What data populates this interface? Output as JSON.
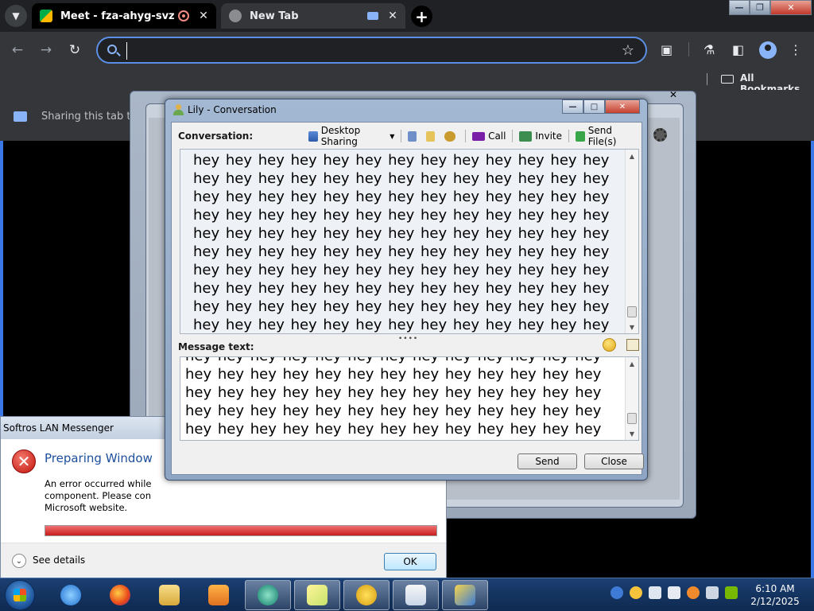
{
  "chrome": {
    "tabs": [
      {
        "title": "Meet - fza-ahyg-svz"
      },
      {
        "title": "New Tab"
      }
    ],
    "omnibox": {
      "value": "",
      "placeholder": ""
    },
    "bookmarks": {
      "all_label": "All Bookmarks"
    },
    "sharing_bar_text": "Sharing this tab to"
  },
  "error_dialog": {
    "title": "Softros LAN Messenger",
    "heading": "Preparing Window",
    "body_line1": "An error occurred while",
    "body_line2": "component. Please con",
    "body_line3": "Microsoft website.",
    "progress_percent": 100,
    "details_label": "See details",
    "ok_label": "OK"
  },
  "conversation": {
    "title": "Lily - Conversation",
    "conversation_label": "Conversation:",
    "tools": {
      "desktop_sharing": "Desktop Sharing",
      "call": "Call",
      "invite": "Invite",
      "send_files": "Send File(s)"
    },
    "history_text": "hey hey hey hey hey hey hey hey hey hey hey hey hey hey hey hey hey hey hey hey hey hey hey hey hey hey hey hey hey hey hey hey hey hey hey hey hey hey hey hey hey hey hey hey hey hey hey hey hey hey hey hey hey hey hey hey hey hey hey hey hey hey hey hey hey hey hey hey hey hey hey hey hey hey hey hey hey hey hey hey hey hey hey hey hey hey hey hey hey hey hey hey hey hey hey hey hey hey hey hey hey hey hey hey hey hey hey hey hey hey hey hey hey hey hey hey hey hey hey hey hey hey hey hey hey hey hey hey hey hey hey hey hey hey hey hey hey hey hey",
    "message_label": "Message text:",
    "message_text": "hey hey hey hey hey hey hey hey hey hey hey hey hey hey hey hey hey hey hey hey hey hey hey hey hey hey hey hey hey hey hey hey hey hey hey hey hey hey hey hey hey hey hey hey hey hey hey hey hey hey hey hey hey hey hey hey hey hey hey hey hey hey hey hey hey hey hey hey hey hey hey hey hey hey hey",
    "send_label": "Send",
    "close_label": "Close"
  },
  "taskbar": {
    "clock_time": "6:10 AM",
    "clock_date": "2/12/2025",
    "apps": [
      "ie-icon",
      "firefox-icon",
      "explorer-icon",
      "media-player-icon",
      "meet-icon",
      "sticky-notes-icon",
      "messenger-icon",
      "java-icon",
      "softros-icon"
    ]
  }
}
